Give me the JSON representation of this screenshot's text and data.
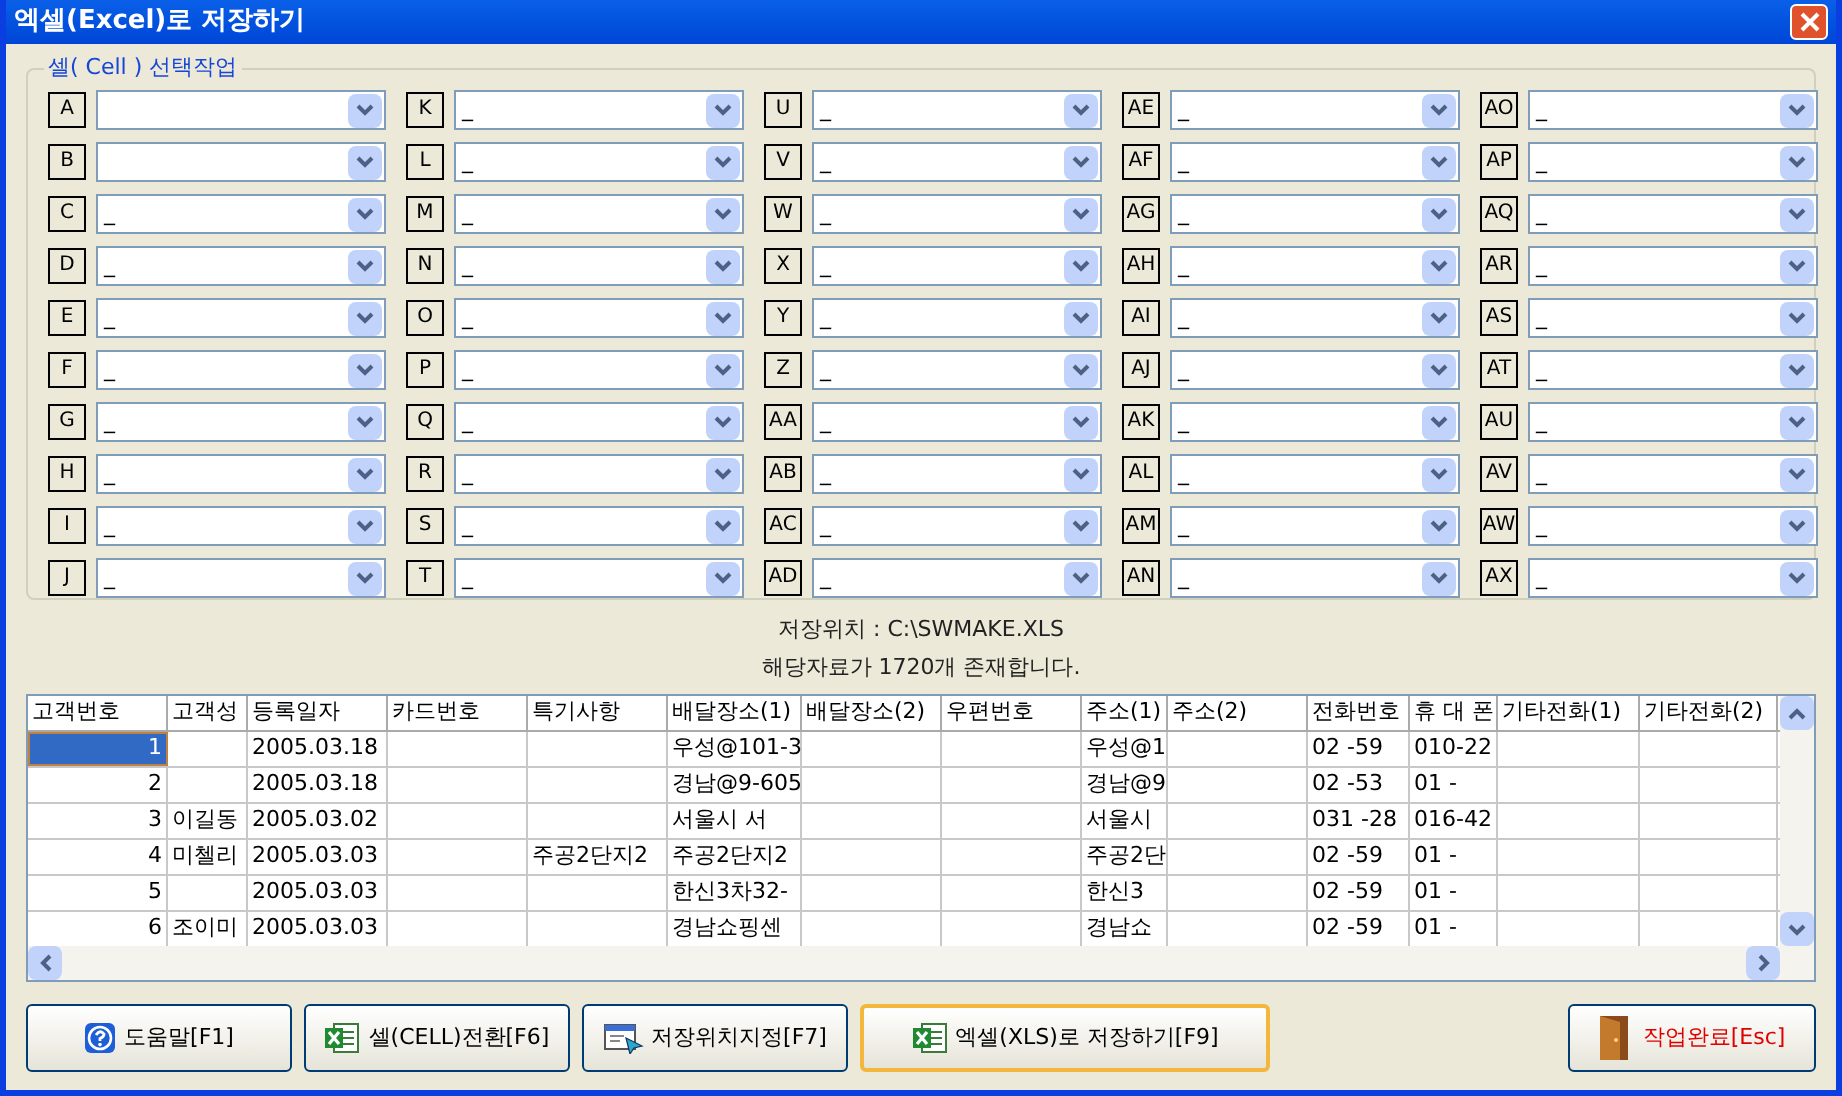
{
  "window": {
    "title": "엑셀(Excel)로 저장하기"
  },
  "cell_group": {
    "title": "셀( Cell ) 선택작업",
    "cells": [
      {
        "label": "A"
      },
      {
        "label": "B"
      },
      {
        "label": "C",
        "value": "_"
      },
      {
        "label": "D",
        "value": "_"
      },
      {
        "label": "E",
        "value": "_"
      },
      {
        "label": "F",
        "value": "_"
      },
      {
        "label": "G",
        "value": "_"
      },
      {
        "label": "H",
        "value": "_"
      },
      {
        "label": "I",
        "value": "_"
      },
      {
        "label": "J",
        "value": "_"
      },
      {
        "label": "K",
        "value": "_"
      },
      {
        "label": "L",
        "value": "_"
      },
      {
        "label": "M",
        "value": "_"
      },
      {
        "label": "N",
        "value": "_"
      },
      {
        "label": "O",
        "value": "_"
      },
      {
        "label": "P",
        "value": "_"
      },
      {
        "label": "Q",
        "value": "_"
      },
      {
        "label": "R",
        "value": "_"
      },
      {
        "label": "S",
        "value": "_"
      },
      {
        "label": "T",
        "value": "_"
      },
      {
        "label": "U",
        "value": "_"
      },
      {
        "label": "V",
        "value": "_"
      },
      {
        "label": "W",
        "value": "_"
      },
      {
        "label": "X",
        "value": "_"
      },
      {
        "label": "Y",
        "value": "_"
      },
      {
        "label": "Z",
        "value": "_"
      },
      {
        "label": "AA",
        "value": "_"
      },
      {
        "label": "AB",
        "value": "_"
      },
      {
        "label": "AC",
        "value": "_"
      },
      {
        "label": "AD",
        "value": "_"
      },
      {
        "label": "AE",
        "value": "_"
      },
      {
        "label": "AF",
        "value": "_"
      },
      {
        "label": "AG",
        "value": "_"
      },
      {
        "label": "AH",
        "value": "_"
      },
      {
        "label": "AI",
        "value": "_"
      },
      {
        "label": "AJ",
        "value": "_"
      },
      {
        "label": "AK",
        "value": "_"
      },
      {
        "label": "AL",
        "value": "_"
      },
      {
        "label": "AM",
        "value": "_"
      },
      {
        "label": "AN",
        "value": "_"
      },
      {
        "label": "AO",
        "value": "_"
      },
      {
        "label": "AP",
        "value": "_"
      },
      {
        "label": "AQ",
        "value": "_"
      },
      {
        "label": "AR",
        "value": "_"
      },
      {
        "label": "AS",
        "value": "_"
      },
      {
        "label": "AT",
        "value": "_"
      },
      {
        "label": "AU",
        "value": "_"
      },
      {
        "label": "AV",
        "value": "_"
      },
      {
        "label": "AW",
        "value": "_"
      },
      {
        "label": "AX",
        "value": "_"
      }
    ]
  },
  "save_location": "저장위치 : C:\\SWMAKE.XLS",
  "record_count": "해당자료가 1720개 존재합니다.",
  "table": {
    "columns": [
      {
        "label": "고객번호",
        "kind": "number"
      },
      {
        "label": "고객성",
        "kind": "text"
      },
      {
        "label": "등록일자",
        "kind": "text"
      },
      {
        "label": "카드번호",
        "kind": "text"
      },
      {
        "label": "특기사항",
        "kind": "text"
      },
      {
        "label": "배달장소(1)",
        "kind": "text"
      },
      {
        "label": "배달장소(2)",
        "kind": "text"
      },
      {
        "label": "우편번호",
        "kind": "text"
      },
      {
        "label": "주소(1)",
        "kind": "text"
      },
      {
        "label": "주소(2)",
        "kind": "text"
      },
      {
        "label": "전화번호",
        "kind": "text"
      },
      {
        "label": "휴 대 폰",
        "kind": "text"
      },
      {
        "label": "기타전화(1)",
        "kind": "text"
      },
      {
        "label": "기타전화(2)",
        "kind": "text"
      }
    ],
    "rows": [
      {
        "selected": true,
        "cells": [
          "1",
          "",
          "2005.03.18",
          "",
          "",
          "우성@101-3",
          "",
          "",
          "우성@1",
          "",
          "02 -59",
          "010-22",
          "",
          ""
        ]
      },
      {
        "selected": false,
        "cells": [
          "2",
          "",
          "2005.03.18",
          "",
          "",
          "경남@9-605",
          "",
          "",
          "경남@9",
          "",
          "02 -53",
          "01 -",
          "",
          ""
        ]
      },
      {
        "selected": false,
        "cells": [
          "3",
          "이길동",
          "2005.03.02",
          "",
          "",
          "서울시 서",
          "",
          "",
          "서울시",
          "",
          "031 -28",
          "016-42",
          "",
          ""
        ]
      },
      {
        "selected": false,
        "cells": [
          "4",
          "미첼리",
          "2005.03.03",
          "",
          "주공2단지2",
          "주공2단지2",
          "",
          "",
          "주공2단",
          "",
          "02 -59",
          "01 -",
          "",
          ""
        ]
      },
      {
        "selected": false,
        "cells": [
          "5",
          "",
          "2005.03.03",
          "",
          "",
          "한신3차32-",
          "",
          "",
          "한신3",
          "",
          "02 -59",
          "01 -",
          "",
          ""
        ]
      },
      {
        "selected": false,
        "cells": [
          "6",
          "조이미",
          "2005.03.03",
          "",
          "",
          "경남쇼핑센",
          "",
          "",
          "경남쇼",
          "",
          "02 -59",
          "01 -",
          "",
          ""
        ]
      }
    ]
  },
  "buttons": [
    {
      "label": "도움말[F1]",
      "kind": "help",
      "focused": false
    },
    {
      "label": "셀(CELL)전환[F6]",
      "kind": "excel",
      "focused": false
    },
    {
      "label": "저장위치지정[F7]",
      "kind": "location",
      "focused": false
    },
    {
      "label": "엑셀(XLS)로 저장하기[F9]",
      "kind": "excel",
      "focused": true
    },
    {
      "label": "작업완료[Esc]",
      "kind": "exit",
      "focused": false
    }
  ]
}
